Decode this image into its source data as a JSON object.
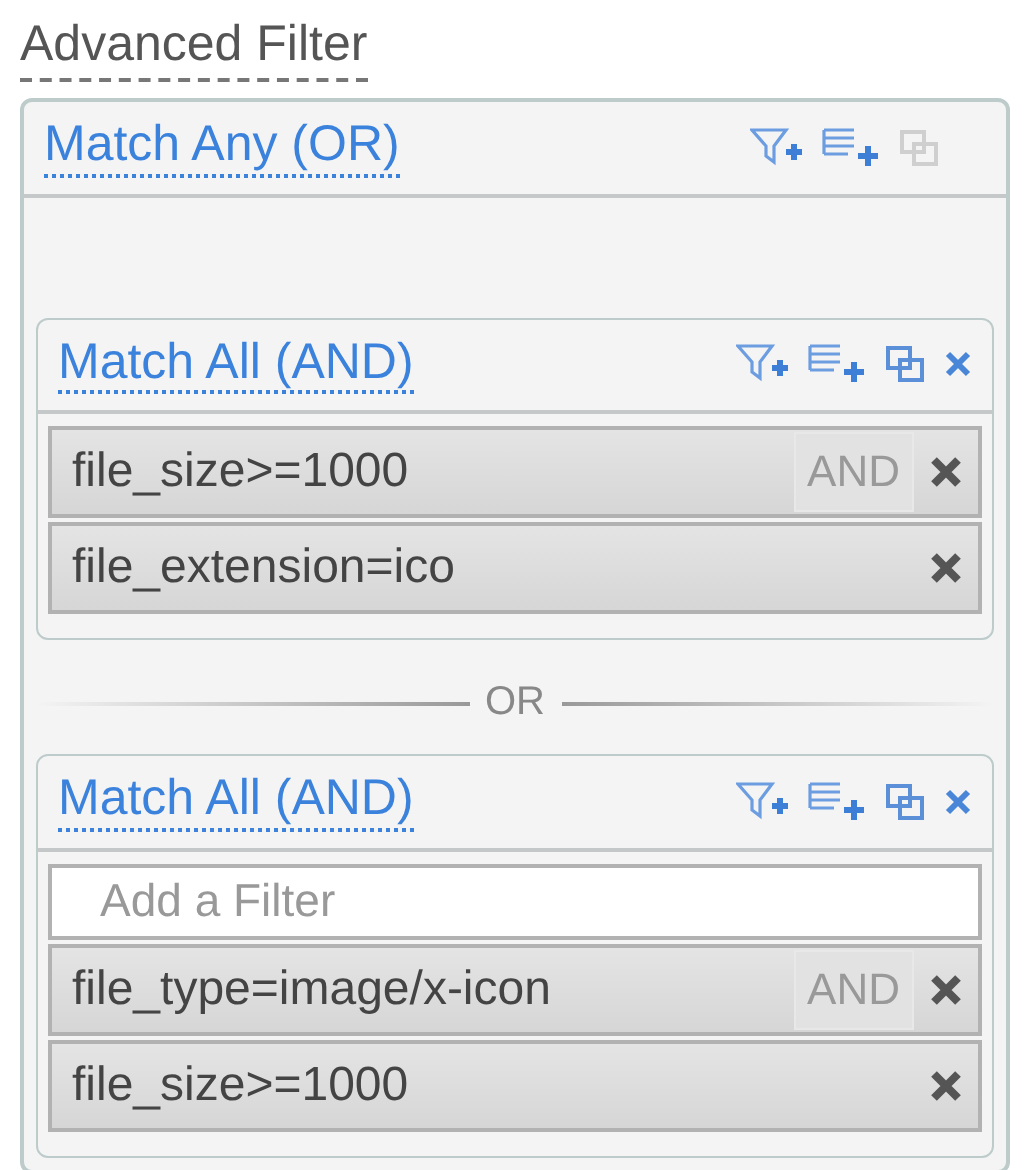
{
  "title": "Advanced Filter",
  "group": {
    "title": "Match Any (OR)",
    "copy_disabled": true,
    "removable": false,
    "children": [
      {
        "title": "Match All (AND)",
        "copy_disabled": false,
        "removable": true,
        "filters": [
          {
            "text": "file_size>=1000",
            "operator": "AND"
          },
          {
            "text": "file_extension=ico"
          }
        ]
      },
      {
        "separator": "OR",
        "title": "Match All (AND)",
        "copy_disabled": false,
        "removable": true,
        "add_placeholder": "Add a Filter",
        "filters": [
          {
            "text": "file_type=image/x-icon",
            "operator": "AND"
          },
          {
            "text": "file_size>=1000"
          }
        ]
      }
    ]
  }
}
